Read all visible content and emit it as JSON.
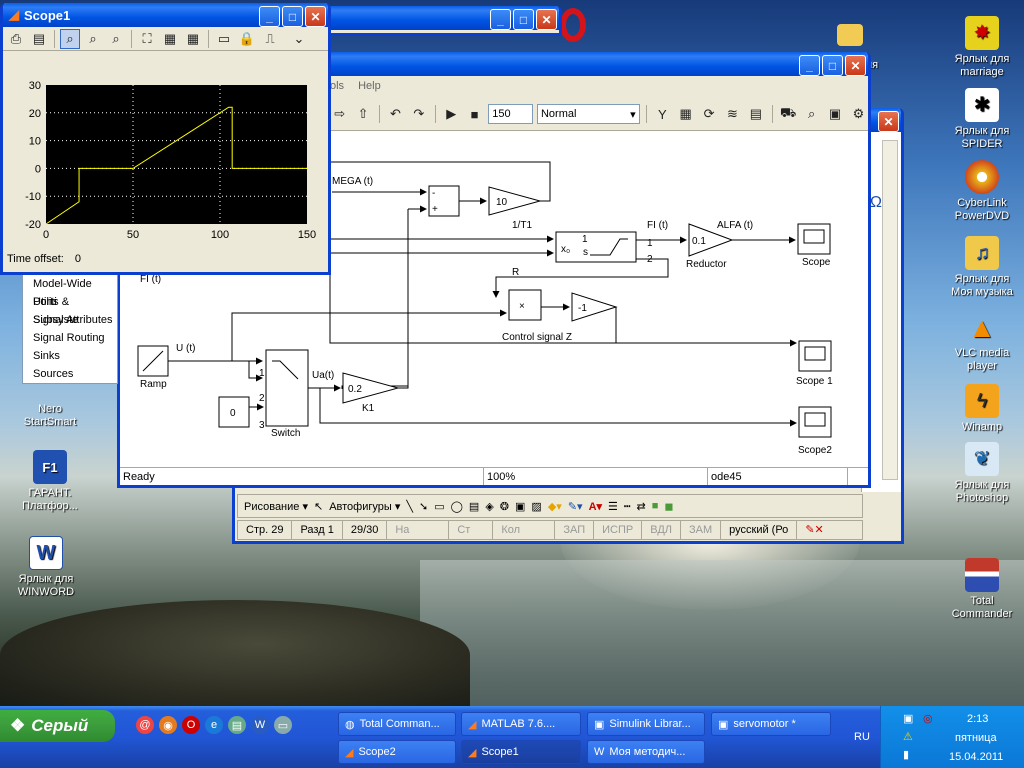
{
  "desktop": {
    "icons": [
      {
        "label": "Ярлык для\nmarriage",
        "icon": "spider-game-icon"
      },
      {
        "label": "Ярлык для\nSPIDER",
        "icon": "spider-icon"
      },
      {
        "label": "CyberLink\nPowerDVD",
        "icon": "dvd-icon"
      },
      {
        "label": "Ярлык для\nМоя музыка",
        "icon": "music-folder-icon"
      },
      {
        "label": "VLC media\nplayer",
        "icon": "vlc-cone-icon"
      },
      {
        "label": "Winamp",
        "icon": "winamp-icon"
      },
      {
        "label": "Ярлык для\nPhotoshop",
        "icon": "photoshop-feather-icon"
      },
      {
        "label": "Total\nCommander",
        "icon": "floppy-icon"
      },
      {
        "label": "Nero\nStartSmart",
        "icon": "nero-icon"
      },
      {
        "label": "ГАРАНТ.\nПлатфор...",
        "icon": "garant-icon"
      },
      {
        "label": "Ярлык для\nWINWORD",
        "icon": "word-icon"
      }
    ],
    "folder_text": "ия"
  },
  "scope_window": {
    "title": "Scope1",
    "time_offset_label": "Time offset:",
    "time_offset_value": "0",
    "colors": {
      "plot_bg": "#000000",
      "trace": "#ffff00",
      "grid": "#ffffff"
    }
  },
  "chart_data": {
    "type": "line",
    "title": "",
    "xlabel": "",
    "ylabel": "",
    "xlim": [
      0,
      150
    ],
    "ylim": [
      -20,
      30
    ],
    "xticks": [
      "0",
      "50",
      "100",
      "150"
    ],
    "yticks": [
      "30",
      "20",
      "10",
      "0",
      "-10",
      "-20"
    ],
    "grid": true,
    "series": [
      {
        "x": [
          0,
          19,
          19,
          50,
          105,
          107,
          107,
          150
        ],
        "values": [
          -20,
          -12,
          0,
          0,
          22,
          22,
          0,
          0
        ]
      }
    ]
  },
  "simulink_window": {
    "menu_visible": [
      "ols",
      "Help"
    ],
    "stop_time": "150",
    "sim_mode": "Normal",
    "status": {
      "ready": "Ready",
      "zoom": "100%",
      "solver": "ode45"
    },
    "blocks": {
      "omega": "MEGA (t)",
      "fi_top": "FI (t)",
      "ten": "10",
      "gain_t1": "1/T1",
      "integrator_num": "1",
      "integrator_den": "s",
      "x0": "x₀",
      "port1": "1",
      "port2": "2",
      "fi_signal": "FI (t)",
      "reductor_val": "0.1",
      "alfa": "ALFA (t)",
      "reductor": "Reductor",
      "scope": "Scope",
      "r": "R",
      "fi_left": "FI (t)",
      "mult": "×",
      "neg1": "-1",
      "control": "Control signal Z",
      "ut": "U (t)",
      "ramp": "Ramp",
      "ua": "Ua(t)",
      "k1_val": "0.2",
      "k1": "K1",
      "scope1": "Scope 1",
      "const0": "0",
      "switch": "Switch",
      "sw1": "1",
      "sw2": "2",
      "sw3": "3",
      "scope2": "Scope2",
      "minus": "-",
      "plus": "+"
    }
  },
  "library_tree": {
    "items": [
      "Model-Wide Utiliti",
      "Ports & Subsyste",
      "Signal Attributes",
      "Signal Routing",
      "Sinks",
      "Sources"
    ]
  },
  "word_window": {
    "drawing_label": "Рисование ▾",
    "autoshapes_label": "Автофигуры ▾",
    "status": {
      "page": "Стр.  29",
      "section": "Разд  1",
      "pages": "29/30",
      "at": "На",
      "line": "Ст",
      "col": "Кол",
      "rec": "ЗАП",
      "trk": "ИСПР",
      "ext": "ВДЛ",
      "ovr": "ЗАМ",
      "lang": "русский (Ро"
    },
    "omega_symbol": "Ω"
  },
  "taskbar": {
    "start_label": "Серый",
    "tasks_top": [
      "Total Comman...",
      "MATLAB  7.6....",
      "Simulink Librar...",
      "servomotor *"
    ],
    "tasks_bottom": [
      "Scope2",
      "Scope1",
      "Моя методич..."
    ],
    "lang": "RU",
    "time": "2:13",
    "day": "пятница",
    "date": "15.04.2011"
  }
}
